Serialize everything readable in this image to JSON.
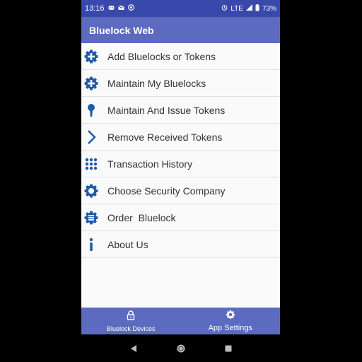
{
  "status_bar": {
    "time": "13:16",
    "network": "LTE",
    "battery": "73%",
    "notification_icons": [
      "discord-icon",
      "mail-icon",
      "at-sign-icon"
    ],
    "status_icons": [
      "alarm-icon",
      "signal-icon",
      "battery-icon"
    ]
  },
  "app_bar": {
    "title": "Bluelock Web"
  },
  "menu": {
    "items": [
      {
        "label": "Add Bluelocks or Tokens",
        "icon": "add-gear-icon"
      },
      {
        "label": "Maintain My Bluelocks",
        "icon": "add-gear-icon"
      },
      {
        "label": "Maintain And Issue Tokens",
        "icon": "keyhole-icon"
      },
      {
        "label": "Remove Received Tokens",
        "icon": "chevron-right-icon"
      },
      {
        "label": "Transaction History",
        "icon": "grid-dots-icon"
      },
      {
        "label": "Choose Security Company",
        "icon": "gear-icon"
      },
      {
        "label": "Order  Bluelock",
        "icon": "list-gear-icon"
      },
      {
        "label": "About Us",
        "icon": "info-icon"
      }
    ]
  },
  "bottom_nav": {
    "devices_label": "Bluelock Devices",
    "settings_label": "App Settings"
  },
  "colors": {
    "status_bar": "#3949AB",
    "primary": "#5C6BC0",
    "icon_blue": "#1E5BA8",
    "background": "#FAFAFA"
  }
}
